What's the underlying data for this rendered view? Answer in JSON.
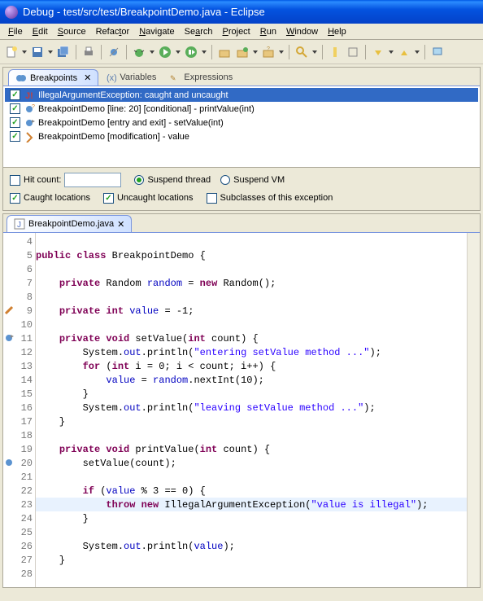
{
  "window": {
    "title": "Debug - test/src/test/BreakpointDemo.java - Eclipse"
  },
  "menu": {
    "file": "File",
    "edit": "Edit",
    "source": "Source",
    "refactor": "Refactor",
    "navigate": "Navigate",
    "search": "Search",
    "project": "Project",
    "run": "Run",
    "window": "Window",
    "help": "Help"
  },
  "views": {
    "breakpoints": {
      "label": "Breakpoints"
    },
    "variables": {
      "label": "Variables"
    },
    "expressions": {
      "label": "Expressions"
    }
  },
  "breakpoints": [
    {
      "checked": true,
      "selected": true,
      "icon": "exception",
      "label": "IllegalArgumentException: caught and uncaught"
    },
    {
      "checked": true,
      "selected": false,
      "icon": "line",
      "label": "BreakpointDemo [line: 20] [conditional] - printValue(int)"
    },
    {
      "checked": true,
      "selected": false,
      "icon": "method",
      "label": "BreakpointDemo [entry and exit] - setValue(int)"
    },
    {
      "checked": true,
      "selected": false,
      "icon": "watch",
      "label": "BreakpointDemo [modification] - value"
    }
  ],
  "bp_options": {
    "hit_count_label": "Hit count:",
    "hit_count_value": "",
    "hit_count_checked": false,
    "suspend_thread_label": "Suspend thread",
    "suspend_thread": true,
    "suspend_vm_label": "Suspend VM",
    "suspend_vm": false,
    "caught_label": "Caught locations",
    "caught": true,
    "uncaught_label": "Uncaught locations",
    "uncaught": true,
    "subclasses_label": "Subclasses of this exception",
    "subclasses": false
  },
  "editor": {
    "filename": "BreakpointDemo.java",
    "lines": [
      {
        "num": 4,
        "mark": null,
        "tokens": []
      },
      {
        "num": 5,
        "mark": null,
        "tokens": [
          [
            "kw",
            "public class"
          ],
          [
            "",
            " BreakpointDemo {"
          ]
        ]
      },
      {
        "num": 6,
        "mark": null,
        "tokens": []
      },
      {
        "num": 7,
        "mark": null,
        "tokens": [
          [
            "",
            "    "
          ],
          [
            "kw",
            "private"
          ],
          [
            "",
            " Random "
          ],
          [
            "fld",
            "random"
          ],
          [
            "",
            " = "
          ],
          [
            "kw",
            "new"
          ],
          [
            "",
            " Random();"
          ]
        ]
      },
      {
        "num": 8,
        "mark": null,
        "tokens": []
      },
      {
        "num": 9,
        "mark": "edit",
        "tokens": [
          [
            "",
            "    "
          ],
          [
            "kw",
            "private int"
          ],
          [
            "",
            " "
          ],
          [
            "fld",
            "value"
          ],
          [
            "",
            " = -1;"
          ]
        ]
      },
      {
        "num": 10,
        "mark": null,
        "tokens": []
      },
      {
        "num": 11,
        "mark": "method",
        "tokens": [
          [
            "",
            "    "
          ],
          [
            "kw",
            "private void"
          ],
          [
            "",
            " setValue("
          ],
          [
            "kw",
            "int"
          ],
          [
            "",
            " count) {"
          ]
        ]
      },
      {
        "num": 12,
        "mark": null,
        "tokens": [
          [
            "",
            "        System."
          ],
          [
            "fld",
            "out"
          ],
          [
            "",
            ".println("
          ],
          [
            "str",
            "\"entering setValue method ...\""
          ],
          [
            "",
            ");"
          ]
        ]
      },
      {
        "num": 13,
        "mark": null,
        "tokens": [
          [
            "",
            "        "
          ],
          [
            "kw",
            "for"
          ],
          [
            "",
            " ("
          ],
          [
            "kw",
            "int"
          ],
          [
            "",
            " i = 0; i < count; i++) {"
          ]
        ]
      },
      {
        "num": 14,
        "mark": null,
        "tokens": [
          [
            "",
            "            "
          ],
          [
            "fld",
            "value"
          ],
          [
            "",
            " = "
          ],
          [
            "fld",
            "random"
          ],
          [
            "",
            ".nextInt(10);"
          ]
        ]
      },
      {
        "num": 15,
        "mark": null,
        "tokens": [
          [
            "",
            "        }"
          ]
        ]
      },
      {
        "num": 16,
        "mark": null,
        "tokens": [
          [
            "",
            "        System."
          ],
          [
            "fld",
            "out"
          ],
          [
            "",
            ".println("
          ],
          [
            "str",
            "\"leaving setValue method ...\""
          ],
          [
            "",
            ");"
          ]
        ]
      },
      {
        "num": 17,
        "mark": null,
        "tokens": [
          [
            "",
            "    }"
          ]
        ]
      },
      {
        "num": 18,
        "mark": null,
        "tokens": []
      },
      {
        "num": 19,
        "mark": null,
        "tokens": [
          [
            "",
            "    "
          ],
          [
            "kw",
            "private void"
          ],
          [
            "",
            " printValue("
          ],
          [
            "kw",
            "int"
          ],
          [
            "",
            " count) {"
          ]
        ]
      },
      {
        "num": 20,
        "mark": "line",
        "tokens": [
          [
            "",
            "        setValue(count);"
          ]
        ]
      },
      {
        "num": 21,
        "mark": null,
        "tokens": []
      },
      {
        "num": 22,
        "mark": null,
        "tokens": [
          [
            "",
            "        "
          ],
          [
            "kw",
            "if"
          ],
          [
            "",
            " ("
          ],
          [
            "fld",
            "value"
          ],
          [
            "",
            " % 3 == 0) {"
          ]
        ]
      },
      {
        "num": 23,
        "mark": null,
        "hl": true,
        "tokens": [
          [
            "",
            "            "
          ],
          [
            "kw",
            "throw new"
          ],
          [
            "",
            " IllegalArgumentException("
          ],
          [
            "str",
            "\"value is illegal\""
          ],
          [
            "",
            ");"
          ]
        ]
      },
      {
        "num": 24,
        "mark": null,
        "tokens": [
          [
            "",
            "        }"
          ]
        ]
      },
      {
        "num": 25,
        "mark": null,
        "tokens": []
      },
      {
        "num": 26,
        "mark": null,
        "tokens": [
          [
            "",
            "        System."
          ],
          [
            "fld",
            "out"
          ],
          [
            "",
            ".println("
          ],
          [
            "fld",
            "value"
          ],
          [
            "",
            ");"
          ]
        ]
      },
      {
        "num": 27,
        "mark": null,
        "tokens": [
          [
            "",
            "    }"
          ]
        ]
      },
      {
        "num": 28,
        "mark": null,
        "tokens": []
      }
    ]
  }
}
